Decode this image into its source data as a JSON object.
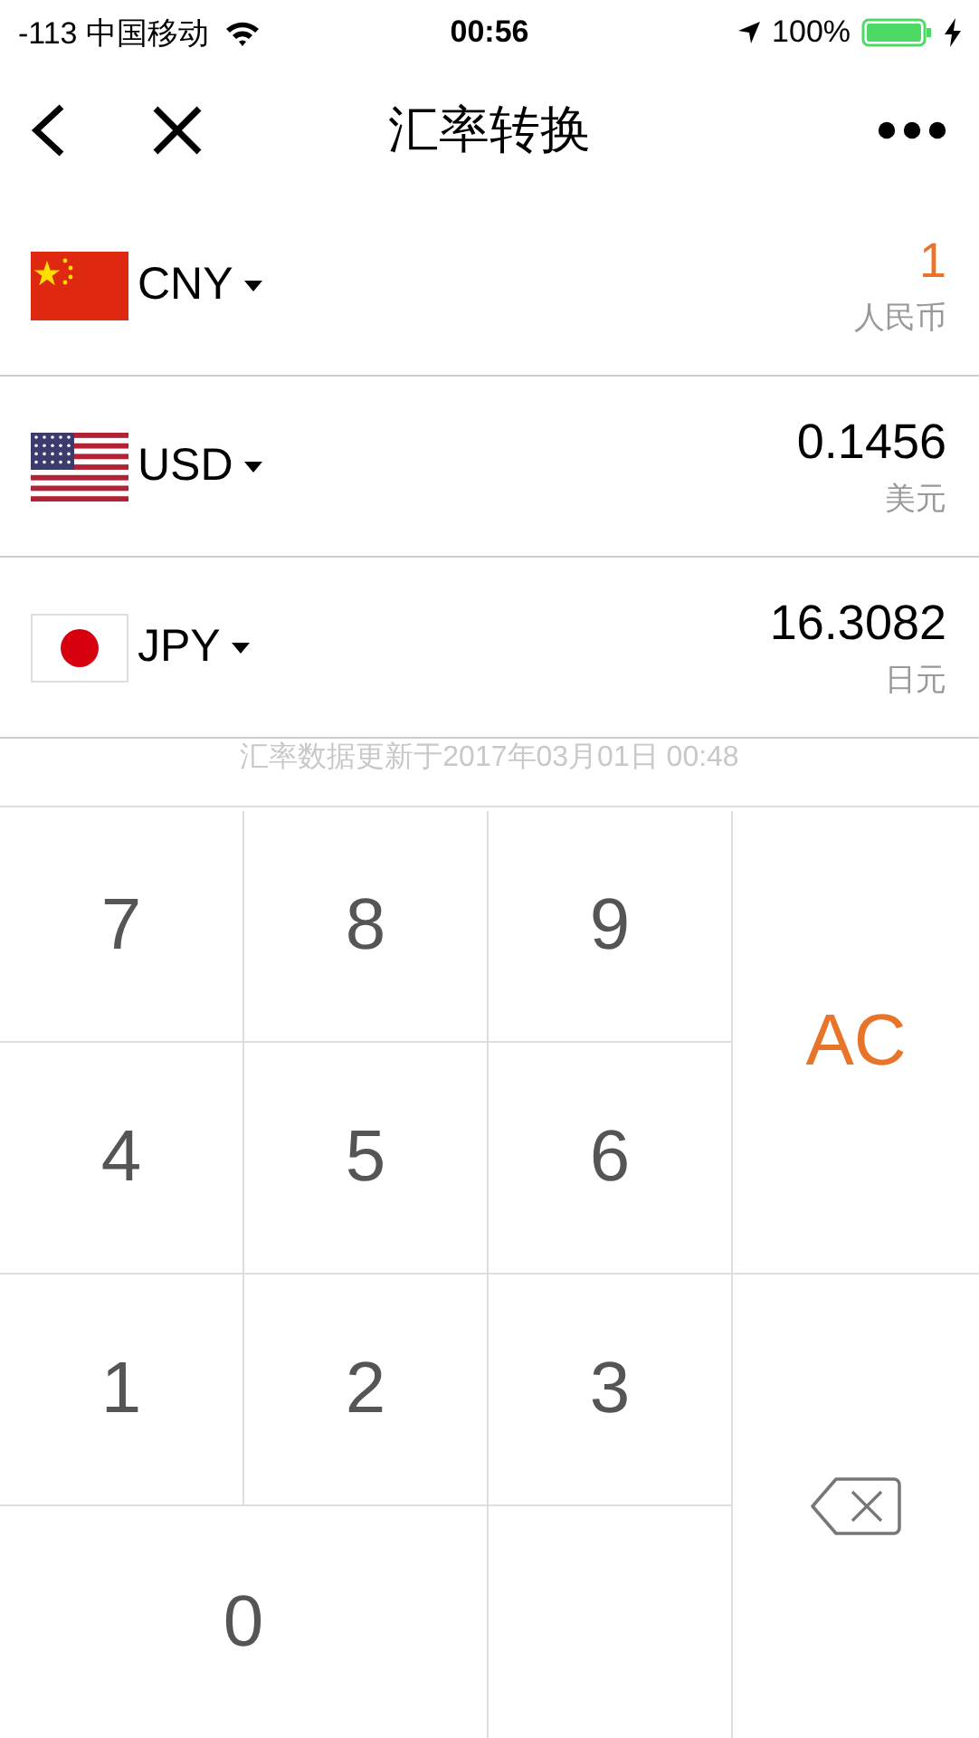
{
  "status_bar": {
    "carrier": "-113 中国移动",
    "time": "00:56",
    "battery": "100%"
  },
  "nav": {
    "title": "汇率转换"
  },
  "currencies": [
    {
      "code": "CNY",
      "kind": "cn",
      "amount": "1",
      "name": "人民币",
      "selected": true
    },
    {
      "code": "USD",
      "kind": "us",
      "amount": "0.1456",
      "name": "美元",
      "selected": false
    },
    {
      "code": "JPY",
      "kind": "jp",
      "amount": "16.3082",
      "name": "日元",
      "selected": false
    }
  ],
  "update_note": "汇率数据更新于2017年03月01日 00:48",
  "keys": [
    {
      "label": "7",
      "kind": "digit"
    },
    {
      "label": "8",
      "kind": "digit"
    },
    {
      "label": "9",
      "kind": "digit"
    },
    {
      "label": "AC",
      "kind": "clear"
    },
    {
      "label": "4",
      "kind": "digit"
    },
    {
      "label": "5",
      "kind": "digit"
    },
    {
      "label": "6",
      "kind": "digit"
    },
    {
      "label": "1",
      "kind": "digit"
    },
    {
      "label": "2",
      "kind": "digit"
    },
    {
      "label": "3",
      "kind": "digit"
    },
    {
      "kind": "backspace"
    },
    {
      "label": "0",
      "kind": "wide"
    },
    {
      "kind": "blank"
    }
  ]
}
